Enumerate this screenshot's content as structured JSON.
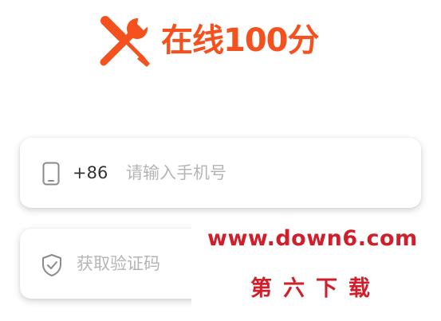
{
  "brand": {
    "name": "在线100分",
    "color": "#f4511e"
  },
  "phone": {
    "country_code": "+86",
    "placeholder": "请输入手机号",
    "value": ""
  },
  "code": {
    "placeholder": "获取验证码",
    "value": ""
  },
  "icons": {
    "logo": "wrench-screwdriver-icon",
    "phone": "phone-icon",
    "code": "shield-check-icon"
  },
  "watermark": {
    "url": "www.down6.com",
    "name": "第六下载",
    "color": "#d01f2b"
  }
}
